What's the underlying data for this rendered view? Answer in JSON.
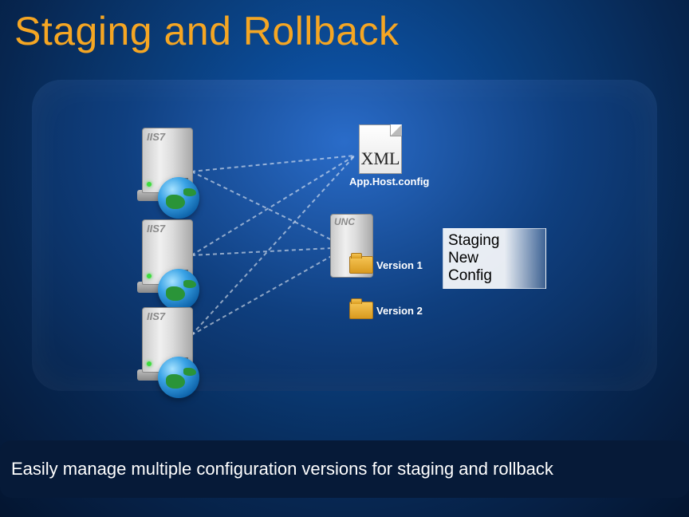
{
  "title": "Staging and Rollback",
  "servers": {
    "s1_tag": "IIS7",
    "s2_tag": "IIS7",
    "s3_tag": "IIS7"
  },
  "xml": {
    "badge": "XML",
    "caption": "App.Host.config"
  },
  "unc": {
    "tag": "UNC"
  },
  "folders": {
    "v1": "Version 1",
    "v2": "Version 2"
  },
  "staging_box": "Staging\nNew\nConfig",
  "footer": "Easily manage multiple configuration versions for staging and rollback"
}
